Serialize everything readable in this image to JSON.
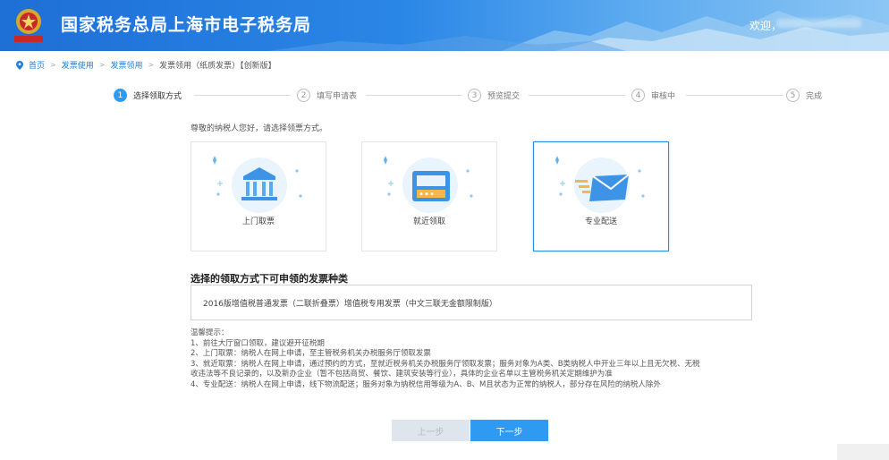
{
  "header": {
    "title": "国家税务总局上海市电子税务局",
    "welcome": "欢迎，"
  },
  "breadcrumb": {
    "items": [
      "首页",
      "发票使用",
      "发票领用"
    ],
    "current": "发票领用（纸质发票）【创新版】"
  },
  "steps": [
    {
      "num": "1",
      "label": "选择领取方式"
    },
    {
      "num": "2",
      "label": "填写申请表"
    },
    {
      "num": "3",
      "label": "预览提交"
    },
    {
      "num": "4",
      "label": "审核中"
    },
    {
      "num": "5",
      "label": "完成"
    }
  ],
  "intro": "尊敬的纳税人您好，请选择领票方式。",
  "options": [
    {
      "label": "上门取票",
      "icon": "bank-building-icon"
    },
    {
      "label": "就近领取",
      "icon": "ticket-machine-icon"
    },
    {
      "label": "专业配送",
      "icon": "envelope-delivery-icon"
    }
  ],
  "selected_option": "专业配送",
  "invoice_types": {
    "title": "选择的领取方式下可申领的发票种类",
    "text": "2016版增值税普通发票（二联折叠票）增值税专用发票（中文三联无金额限制版）"
  },
  "tips": [
    "温馨提示：",
    "1、前往大厅窗口领取，建议避开征税期",
    "2、上门取票：纳税人在网上申请，至主管税务机关办税服务厅领取发票",
    "3、就近取票：纳税人在网上申请，通过预约的方式，至就近税务机关办税服务厅领取发票；服务对象为A类、B类纳税人中开业三年以上且无欠税、无税",
    "收违法等不良记录的，以及新办企业（暂不包括商贸、餐饮、建筑安装等行业），具体的企业名单以主管税务机关定期维护为准",
    "4、专业配送：纳税人在网上申请，线下物流配送；服务对象为纳税信用等级为A、B、M且状态为正常的纳税人，部分存在风险的纳税人除外"
  ],
  "buttons": {
    "prev": "上一步",
    "next": "下一步"
  },
  "colors": {
    "accent": "#2d9cf0",
    "header_blue": "#1e6fd6",
    "disabled": "#dfe5ec"
  }
}
